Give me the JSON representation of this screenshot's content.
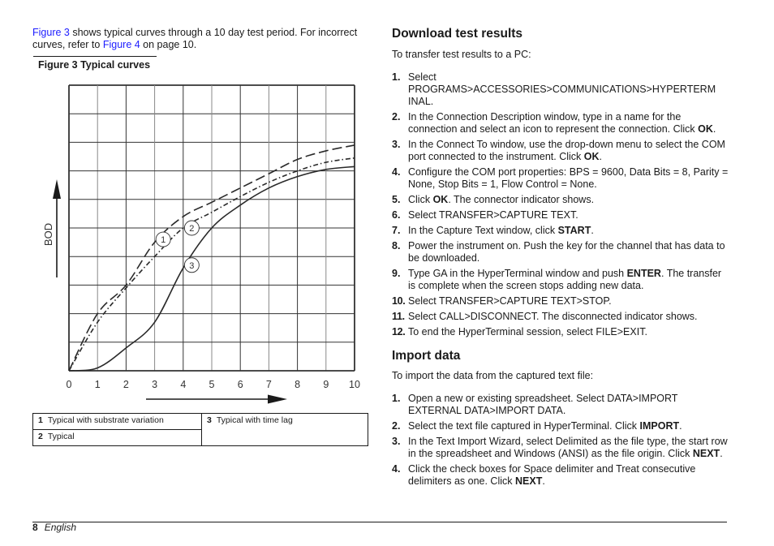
{
  "intro": {
    "link1": "Figure 3",
    "text1": " shows typical curves through a 10 day test period. For incorrect curves, refer to ",
    "link2": "Figure 4",
    "text2": " on page 10."
  },
  "figure": {
    "caption": "Figure 3  Typical curves"
  },
  "chart_data": {
    "type": "line",
    "title": "Figure 3  Typical curves",
    "xlabel": "",
    "ylabel": "BOD",
    "x": [
      0,
      1,
      2,
      3,
      4,
      5,
      6,
      7,
      8,
      9,
      10
    ],
    "xlim": [
      0,
      10
    ],
    "ylim": [
      0,
      10
    ],
    "x_ticks": [
      "0",
      "1",
      "2",
      "3",
      "4",
      "5",
      "6",
      "7",
      "8",
      "9",
      "10"
    ],
    "y_ticks": [],
    "grid": true,
    "series": [
      {
        "name": "1",
        "label": "Typical with substrate variation",
        "style": "dashed",
        "values": [
          0,
          2.0,
          3.0,
          4.5,
          5.4,
          5.9,
          6.4,
          6.9,
          7.4,
          7.7,
          7.9
        ]
      },
      {
        "name": "2",
        "label": "Typical",
        "style": "dash-dot",
        "values": [
          0,
          1.7,
          2.9,
          4.0,
          5.0,
          5.55,
          6.1,
          6.6,
          7.0,
          7.3,
          7.45
        ]
      },
      {
        "name": "3",
        "label": "Typical with time lag",
        "style": "solid",
        "values": [
          0,
          0.1,
          0.8,
          1.7,
          3.6,
          5.0,
          5.8,
          6.4,
          6.8,
          7.05,
          7.15
        ]
      }
    ],
    "annotations": [
      {
        "text": "1",
        "x": 3.3,
        "y": 4.6
      },
      {
        "text": "2",
        "x": 4.3,
        "y": 5.0
      },
      {
        "text": "3",
        "x": 4.3,
        "y": 3.7
      }
    ]
  },
  "legend": [
    {
      "num": "1",
      "label": "Typical with substrate variation"
    },
    {
      "num": "2",
      "label": "Typical"
    },
    {
      "num": "3",
      "label": "Typical with time lag"
    }
  ],
  "download": {
    "heading": "Download test results",
    "intro": "To transfer test results to a PC:",
    "steps": [
      {
        "n": "1.",
        "html": "Select PROGRAMS&gt;ACCESSORIES&gt;COMMUNICATIONS&gt;HYPERTERM INAL."
      },
      {
        "n": "2.",
        "html": "In the Connection Description window, type in a name for the connection and select an icon to represent the connection. Click <b>OK</b>."
      },
      {
        "n": "3.",
        "html": "In the Connect To window, use the drop-down menu to select the COM port connected to the instrument. Click <b>OK</b>."
      },
      {
        "n": "4.",
        "html": "Configure the COM port properties: BPS = 9600, Data Bits = 8, Parity = None, Stop Bits = 1, Flow Control = None."
      },
      {
        "n": "5.",
        "html": "Click <b>OK</b>. The connector indicator shows."
      },
      {
        "n": "6.",
        "html": "Select TRANSFER&gt;CAPTURE TEXT."
      },
      {
        "n": "7.",
        "html": "In the Capture Text window, click <b>START</b>."
      },
      {
        "n": "8.",
        "html": "Power the instrument on. Push the key for the channel that has data to be downloaded."
      },
      {
        "n": "9.",
        "html": "Type GA in the HyperTerminal window and push <b>ENTER</b>. The transfer is complete when the screen stops adding new data."
      },
      {
        "n": "10.",
        "html": "Select TRANSFER&gt;CAPTURE TEXT&gt;STOP."
      },
      {
        "n": "11.",
        "html": "Select CALL&gt;DISCONNECT. The disconnected indicator shows."
      },
      {
        "n": "12.",
        "html": "To end the HyperTerminal session, select FILE&gt;EXIT."
      }
    ]
  },
  "import": {
    "heading": "Import data",
    "intro": "To import the data from the captured text file:",
    "steps": [
      {
        "n": "1.",
        "html": "Open a new or existing spreadsheet. Select DATA&gt;IMPORT EXTERNAL DATA&gt;IMPORT DATA."
      },
      {
        "n": "2.",
        "html": "Select the text file captured in HyperTerminal. Click <b>IMPORT</b>."
      },
      {
        "n": "3.",
        "html": "In the Text Import Wizard, select Delimited as the file type, the start row in the spreadsheet and Windows (ANSI) as the file origin. Click <b>NEXT</b>."
      },
      {
        "n": "4.",
        "html": "Click the check boxes for Space delimiter and Treat consecutive delimiters as one. Click <b>NEXT</b>."
      }
    ]
  },
  "footer": {
    "page": "8",
    "language": "English"
  }
}
